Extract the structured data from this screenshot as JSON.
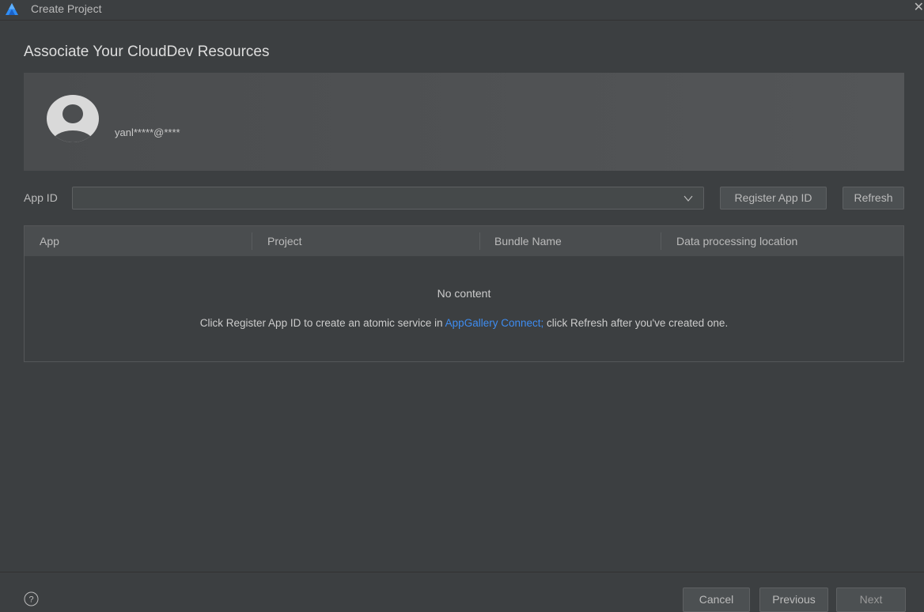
{
  "window": {
    "title": "Create Project"
  },
  "page": {
    "heading": "Associate Your CloudDev Resources"
  },
  "account": {
    "email": "yanl*****@****"
  },
  "app_id": {
    "label": "App ID",
    "value": "",
    "register_label": "Register App ID",
    "refresh_label": "Refresh"
  },
  "table": {
    "columns": [
      "App",
      "Project",
      "Bundle Name",
      "Data processing location"
    ],
    "rows": [],
    "empty_title": "No content",
    "hint_before": "Click Register App ID to create an atomic service in ",
    "hint_link": "AppGallery Connect;",
    "hint_after": " click Refresh after you've created one."
  },
  "footer": {
    "cancel_label": "Cancel",
    "previous_label": "Previous",
    "next_label": "Next"
  },
  "colors": {
    "link": "#3e8cf0",
    "background": "#3c3f41"
  }
}
